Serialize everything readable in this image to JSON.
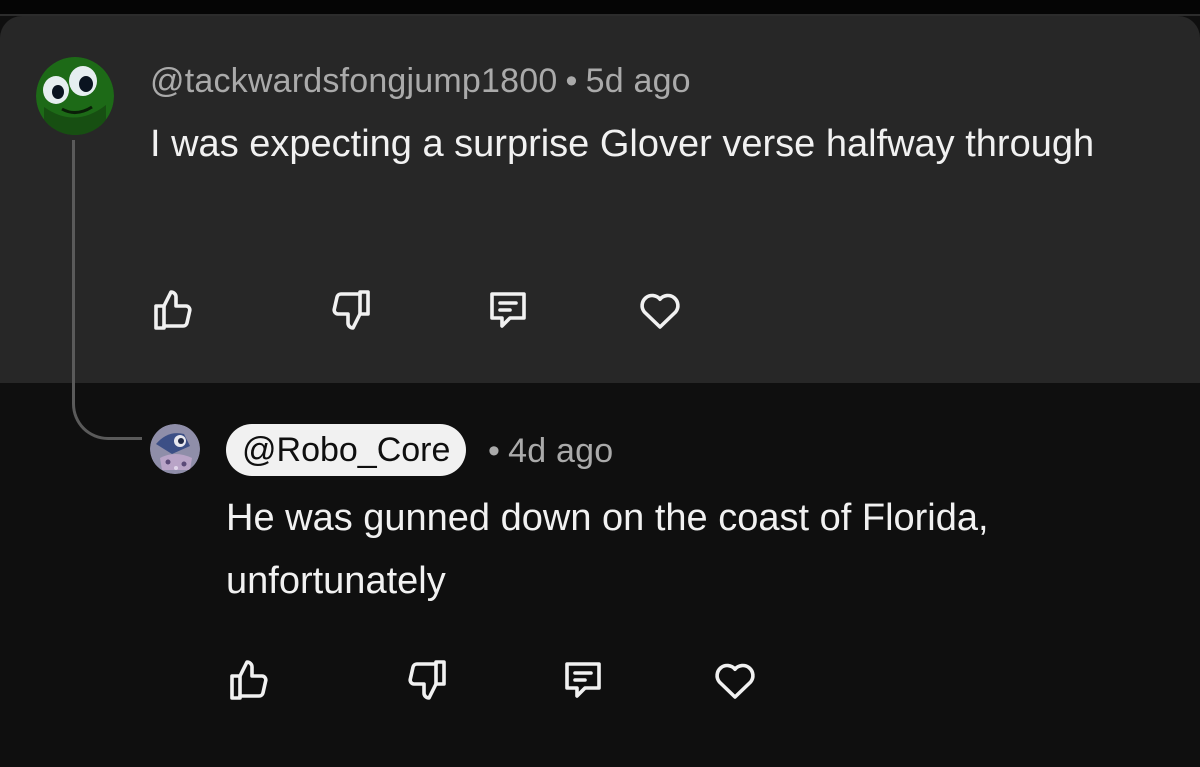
{
  "comment": {
    "handle": "@tackwardsfongjump1800",
    "separator": "•",
    "time": "5d ago",
    "text": "I was expecting a surprise Glover verse halfway through",
    "avatar_icon": "avatar-googly-eyes-icon",
    "actions": [
      "like-icon",
      "dislike-icon",
      "reply-icon",
      "heart-icon"
    ]
  },
  "reply": {
    "handle": "@Robo_Core",
    "separator": "•",
    "time": "4d ago",
    "text": "He was gunned down on the coast of Florida, unfortunately",
    "avatar_icon": "avatar-robot-icon",
    "actions": [
      "like-icon",
      "dislike-icon",
      "reply-icon",
      "heart-icon"
    ]
  },
  "colors": {
    "parent_background": "#272727",
    "page_background": "#0f0f0f",
    "text_primary": "#f1f1f1",
    "text_secondary": "#aaaaaa",
    "handle_chip": "#f1f1f1"
  }
}
